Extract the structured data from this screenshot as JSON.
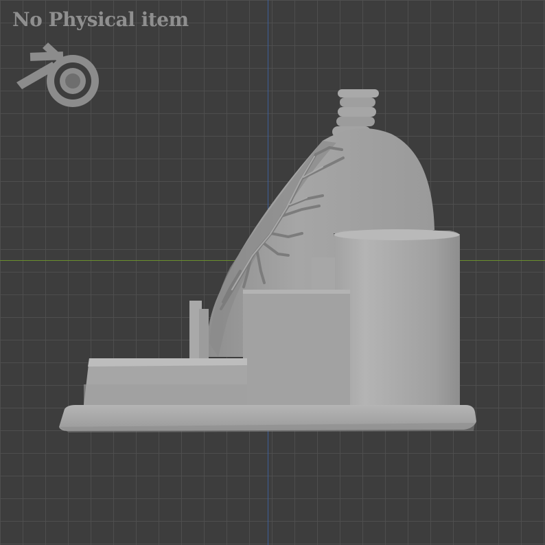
{
  "viewport": {
    "watermark_text": "No Physical item",
    "logo_icon": "blender-logo-icon",
    "colors": {
      "background": "#3d3d3d",
      "grid": "#505050",
      "x_axis": "#6b8f2d",
      "z_axis": "#3d5f9a",
      "model": "#a8a8a8",
      "watermark": "#8f8f8f"
    }
  }
}
